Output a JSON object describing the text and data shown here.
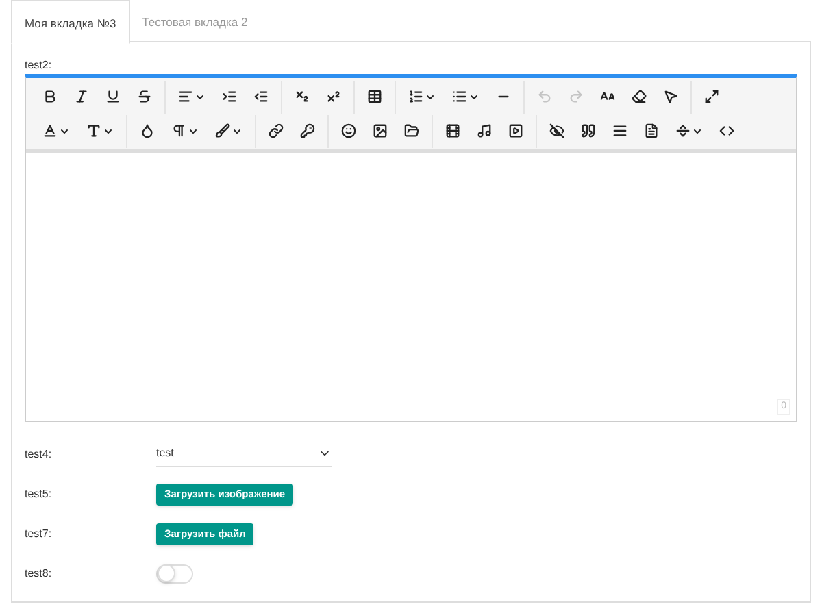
{
  "tabs": [
    {
      "label": "Моя вкладка №3",
      "selected": true
    },
    {
      "label": "Тестовая вкладка 2",
      "selected": false
    }
  ],
  "editor": {
    "label": "test2:",
    "toolbar": [
      [
        [
          {
            "kind": "bold",
            "disabled": false
          },
          {
            "kind": "italic",
            "disabled": false
          },
          {
            "kind": "underline",
            "disabled": false
          },
          {
            "kind": "strike",
            "disabled": false
          }
        ],
        [
          {
            "kind": "align",
            "disabled": false,
            "caret": true
          },
          {
            "kind": "indent",
            "disabled": false
          },
          {
            "kind": "outdent",
            "disabled": false
          }
        ],
        [
          {
            "kind": "subscript",
            "disabled": false
          },
          {
            "kind": "superscript",
            "disabled": false
          }
        ],
        [
          {
            "kind": "table",
            "disabled": false
          }
        ],
        [
          {
            "kind": "ordered-list",
            "disabled": false,
            "caret": true
          },
          {
            "kind": "bullet-list",
            "disabled": false,
            "caret": true
          },
          {
            "kind": "rule",
            "disabled": false
          }
        ],
        [
          {
            "kind": "undo",
            "disabled": true
          },
          {
            "kind": "redo",
            "disabled": true
          },
          {
            "kind": "font-size",
            "disabled": false
          },
          {
            "kind": "eraser",
            "disabled": false
          },
          {
            "kind": "pointer",
            "disabled": false
          }
        ],
        [
          {
            "kind": "fullscreen",
            "disabled": false
          }
        ]
      ],
      [
        [
          {
            "kind": "text-color",
            "disabled": false,
            "caret": true
          },
          {
            "kind": "font",
            "disabled": false,
            "caret": true
          }
        ],
        [
          {
            "kind": "droplet",
            "disabled": false
          },
          {
            "kind": "paragraph",
            "disabled": false,
            "caret": true
          },
          {
            "kind": "brush",
            "disabled": false,
            "caret": true
          }
        ],
        [
          {
            "kind": "link",
            "disabled": false
          },
          {
            "kind": "key",
            "disabled": false
          }
        ],
        [
          {
            "kind": "emoji",
            "disabled": false
          },
          {
            "kind": "image",
            "disabled": false
          },
          {
            "kind": "folder",
            "disabled": false
          }
        ],
        [
          {
            "kind": "video",
            "disabled": false
          },
          {
            "kind": "music",
            "disabled": false
          },
          {
            "kind": "play",
            "disabled": false
          }
        ],
        [
          {
            "kind": "hidden",
            "disabled": false
          },
          {
            "kind": "quote",
            "disabled": false
          },
          {
            "kind": "lines",
            "disabled": false
          },
          {
            "kind": "file",
            "disabled": false
          },
          {
            "kind": "separator",
            "disabled": false,
            "caret": true
          },
          {
            "kind": "code",
            "disabled": false
          }
        ]
      ]
    ],
    "counter": "0"
  },
  "fields": [
    {
      "kind": "select",
      "label": "test4:",
      "value": "test"
    },
    {
      "kind": "button",
      "label": "test5:",
      "button": "Загрузить изображение"
    },
    {
      "kind": "button",
      "label": "test7:",
      "button": "Загрузить файл"
    },
    {
      "kind": "toggle",
      "label": "test8:",
      "on": false
    }
  ]
}
